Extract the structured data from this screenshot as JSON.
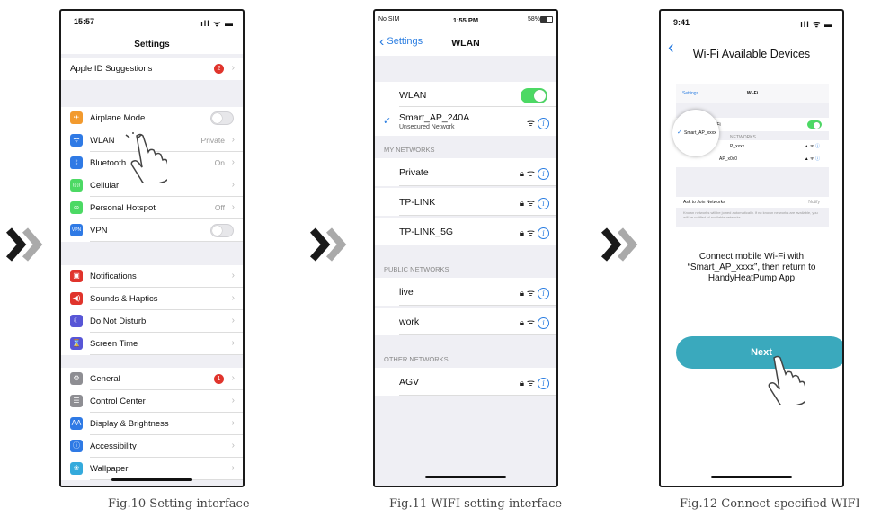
{
  "p1": {
    "time": "15:57",
    "status_icons": "ıll ᯤ ▬",
    "title": "Settings",
    "apple_id": "Apple ID Suggestions",
    "apple_badge": "2",
    "rows_a": [
      {
        "label": "Airplane Mode",
        "value": "",
        "icon_color": "#f29a2e",
        "glyph": "✈"
      },
      {
        "label": "WLAN",
        "value": "Private",
        "icon_color": "#2f7ae5",
        "glyph": "ᯤ"
      },
      {
        "label": "Bluetooth",
        "value": "On",
        "icon_color": "#2f7ae5",
        "glyph": "ᛒ"
      },
      {
        "label": "Cellular",
        "value": "",
        "icon_color": "#4cd964",
        "glyph": "((·))"
      },
      {
        "label": "Personal Hotspot",
        "value": "Off",
        "icon_color": "#4cd964",
        "glyph": "∞"
      },
      {
        "label": "VPN",
        "value": "",
        "icon_color": "#2f7ae5",
        "glyph": "VPN"
      }
    ],
    "rows_b": [
      {
        "label": "Notifications",
        "icon_color": "#e0342c",
        "glyph": "▣"
      },
      {
        "label": "Sounds & Haptics",
        "icon_color": "#e0342c",
        "glyph": "◀)"
      },
      {
        "label": "Do Not Disturb",
        "icon_color": "#5856d6",
        "glyph": "☾"
      },
      {
        "label": "Screen Time",
        "icon_color": "#5856d6",
        "glyph": "⌛"
      }
    ],
    "rows_c": [
      {
        "label": "General",
        "icon_color": "#8e8e93",
        "glyph": "⚙"
      },
      {
        "label": "Control Center",
        "icon_color": "#8e8e93",
        "glyph": "☰"
      },
      {
        "label": "Display & Brightness",
        "icon_color": "#2f7ae5",
        "glyph": "AA"
      },
      {
        "label": "Accessibility",
        "icon_color": "#2f7ae5",
        "glyph": "ⓘ"
      },
      {
        "label": "Wallpaper",
        "icon_color": "#34aadc",
        "glyph": "❀"
      }
    ],
    "general_badge": "1",
    "caption": "Fig.10 Setting interface"
  },
  "p2": {
    "carrier": "No SIM",
    "time": "1:55 PM",
    "battery": "58%",
    "back": "Settings",
    "title": "WLAN",
    "wlan": "WLAN",
    "current_ssid": "Smart_AP_240A",
    "current_sub": "Unsecured Network",
    "sec_my": "MY NETWORKS",
    "my": [
      "Private",
      "TP-LINK",
      "TP-LINK_5G"
    ],
    "sec_public": "PUBLIC NETWORKS",
    "public": [
      "live",
      "work"
    ],
    "sec_other": "OTHER NETWORKS",
    "other": [
      "AGV"
    ],
    "caption": "Fig.11 WIFI setting interface"
  },
  "p3": {
    "time": "9:41",
    "title": "Wi-Fi Available Devices",
    "mini_back": "Settings",
    "mini_title": "Wi-Fi",
    "mini_wifi": "Wi-Fi",
    "mini_networks": "NETWORKS",
    "mini_ssid": "Smart_AP_xxxx",
    "mini_net1": "P_xxxx",
    "mini_net2": "AP_x0x0",
    "mini_ask": "Ask to Join Networks",
    "mini_notify": "Notify",
    "mini_note": "Known networks will be joined automatically. If no known networks are available, you will be notified of available networks.",
    "instruction_1": "Connect mobile Wi-Fi with",
    "instruction_2": "“Smart_AP_xxxx”, then return to",
    "instruction_3": "HandyHeatPump App",
    "next": "Next",
    "accent": "#3aa9bd",
    "caption": "Fig.12 Connect specified WIFI"
  }
}
